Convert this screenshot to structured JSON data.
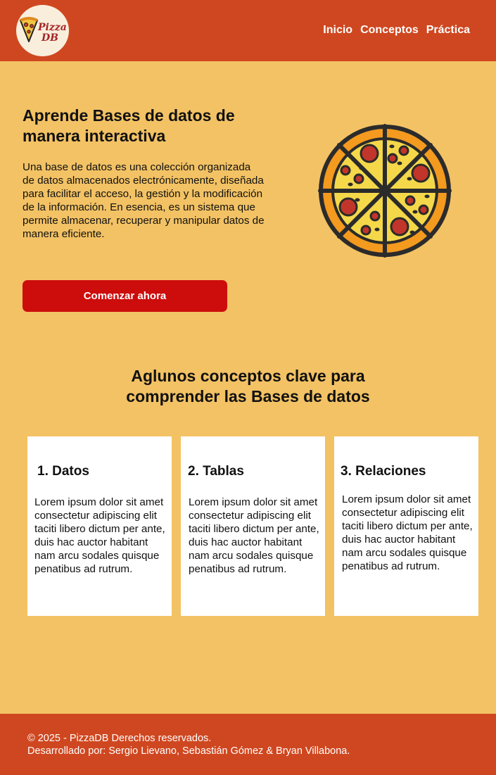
{
  "header": {
    "logo_text_line1": "Pizza",
    "logo_text_line2": "DB",
    "nav": [
      "Inicio",
      "Conceptos",
      "Práctica"
    ]
  },
  "hero": {
    "title": "Aprende Bases de datos de manera interactiva",
    "description": "Una base de datos es una colección organizada de datos almacenados electrónicamente, diseñada para facilitar el acceso, la gestión y la modificación de la información. En esencia, es un sistema que permite almacenar, recuperar y manipular datos de manera eficiente.",
    "cta_label": "Comenzar ahora",
    "image_icon": "pizza-icon"
  },
  "concepts": {
    "title_line1": "Aglunos conceptos clave para",
    "title_line2": "comprender las Bases de datos",
    "cards": [
      {
        "title": "1. Datos",
        "text": "Lorem ipsum dolor sit amet consectetur adipiscing elit taciti libero dictum per ante, duis hac auctor habitant nam arcu sodales quisque penatibus ad rutrum."
      },
      {
        "title": "2. Tablas",
        "text": "Lorem ipsum dolor sit amet consectetur adipiscing elit taciti libero dictum per ante, duis hac auctor habitant nam arcu sodales quisque penatibus ad rutrum."
      },
      {
        "title": "3. Relaciones",
        "text": "Lorem ipsum dolor sit amet consectetur adipiscing elit taciti libero dictum per ante, duis hac auctor habitant nam arcu sodales quisque penatibus ad rutrum."
      }
    ]
  },
  "footer": {
    "line1": "© 2025 - PizzaDB Derechos reservados.",
    "line2": "Desarrollado por: Sergio Lievano, Sebastián Gómez & Bryan Villabona."
  },
  "colors": {
    "header_bg": "#cf4720",
    "page_bg": "#f3c264",
    "cta_bg": "#cd0c0c",
    "card_bg": "#ffffff"
  }
}
